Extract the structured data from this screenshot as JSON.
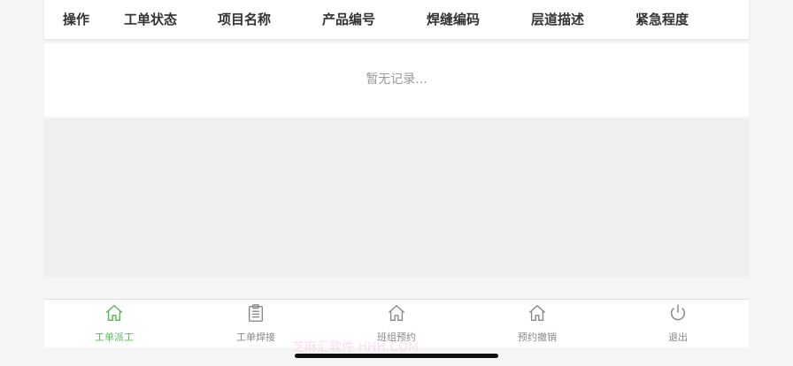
{
  "table": {
    "columns": [
      "操作",
      "工单状态",
      "项目名称",
      "产品编号",
      "焊缝编码",
      "层道描述",
      "紧急程度"
    ],
    "empty_text": "暂无记录..."
  },
  "tabbar": {
    "items": [
      {
        "label": "工单派工",
        "icon": "home-icon",
        "active": true
      },
      {
        "label": "工单焊接",
        "icon": "clipboard-icon",
        "active": false
      },
      {
        "label": "班组预约",
        "icon": "home-icon",
        "active": false
      },
      {
        "label": "预约撤销",
        "icon": "home-icon",
        "active": false
      },
      {
        "label": "退出",
        "icon": "power-icon",
        "active": false
      }
    ],
    "active_color": "#5cb85c",
    "inactive_color": "#888888"
  },
  "watermark": "芝麻汇软件 HHH.COM"
}
